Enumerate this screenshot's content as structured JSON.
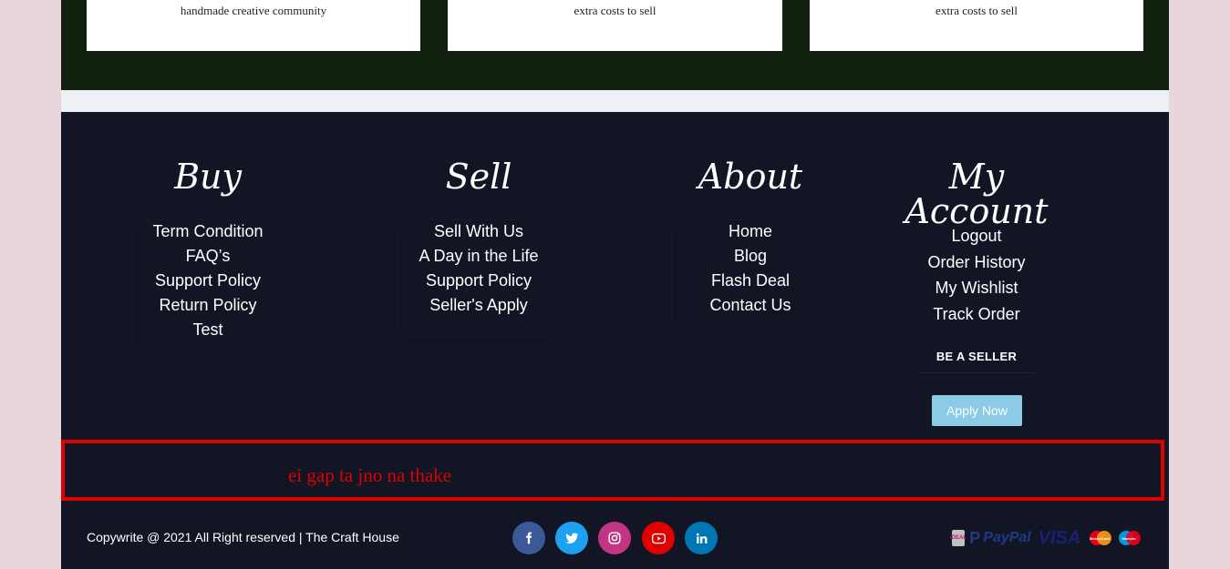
{
  "cards": [
    {
      "text": "handmade creative community"
    },
    {
      "text": "extra costs to sell"
    },
    {
      "text": "extra costs to sell"
    }
  ],
  "footer": {
    "buy": {
      "title": "Buy",
      "links": [
        "Term Condition",
        "FAQ’s",
        "Support Policy",
        "Return Policy",
        "Test"
      ]
    },
    "sell": {
      "title": "Sell",
      "links": [
        "Sell With Us",
        "A Day in the Life",
        "Support Policy",
        "Seller's Apply"
      ]
    },
    "about": {
      "title": "About",
      "links": [
        "Home",
        "Blog",
        "Flash Deal",
        "Contact Us"
      ]
    },
    "account": {
      "title": "My Account",
      "links": [
        "Logout",
        "Order History",
        "My Wishlist",
        "Track Order"
      ],
      "seller_title": "BE A SELLER",
      "apply_label": "Apply Now"
    }
  },
  "annotation": {
    "text": "ei gap ta jno na thake",
    "color": "#e00000"
  },
  "bottom": {
    "copyright": "Copywrite @ 2021 All Right reserved | The Craft House",
    "social": [
      {
        "name": "facebook-icon",
        "glyph": "f",
        "color": "#3b5998"
      },
      {
        "name": "twitter-icon",
        "glyph": "t",
        "color": "#1da1f2"
      },
      {
        "name": "instagram-icon",
        "glyph": "◎",
        "color": "#c13584"
      },
      {
        "name": "youtube-icon",
        "glyph": "▶",
        "color": "#e00000"
      },
      {
        "name": "linkedin-icon",
        "glyph": "in",
        "color": "#0077b5"
      }
    ],
    "payments": {
      "ideal": "iDEAL",
      "paypal": "PayPal",
      "visa": "VISA",
      "mastercard": "MasterCard",
      "maestro": "Maestro"
    }
  },
  "colors": {
    "footer_bg": "#121624",
    "top_band": "#11200f",
    "apply_button": "#8ccbe5"
  }
}
